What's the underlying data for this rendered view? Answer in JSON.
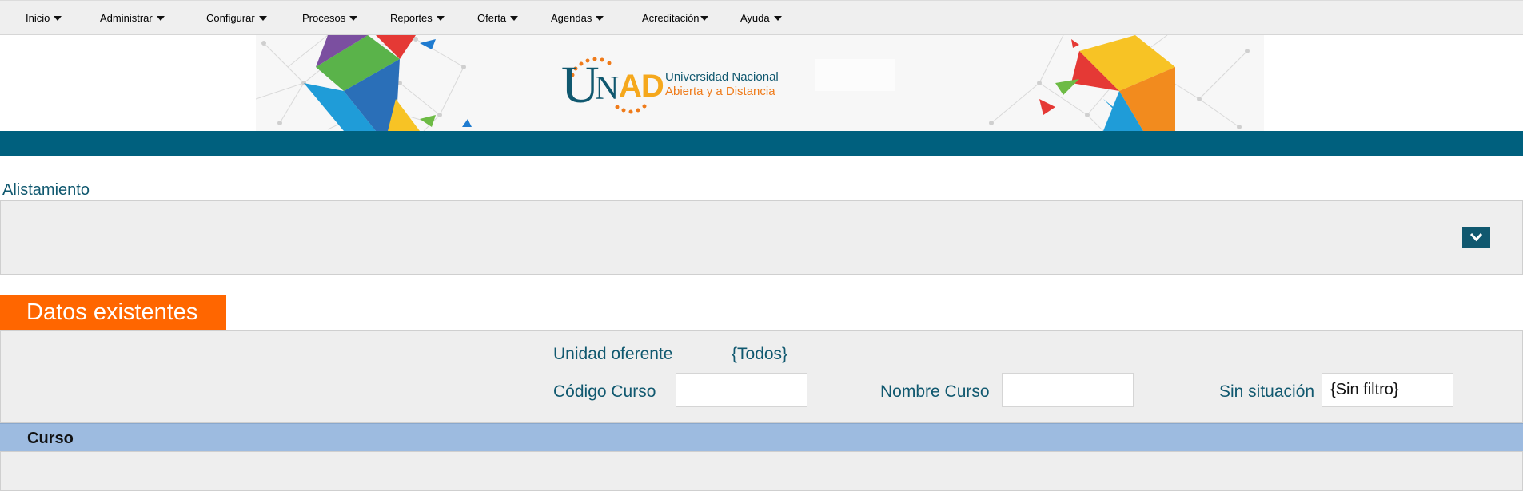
{
  "menu": {
    "items": [
      {
        "label": "Inicio"
      },
      {
        "label": "Administrar"
      },
      {
        "label": "Configurar"
      },
      {
        "label": "Procesos"
      },
      {
        "label": "Reportes"
      },
      {
        "label": "Oferta"
      },
      {
        "label": "Agendas"
      },
      {
        "label": "Acreditación"
      },
      {
        "label": "Ayuda"
      }
    ]
  },
  "banner": {
    "logo_text": "UNAD",
    "line1": "Universidad Nacional",
    "line2": "Abierta y a Distancia"
  },
  "section": {
    "title": "Alistamiento"
  },
  "datos": {
    "tab_label": "Datos existentes",
    "unidad_label": "Unidad oferente",
    "unidad_value": "{Todos}",
    "codigo_label": "Código Curso",
    "codigo_value": "",
    "nombre_label": "Nombre Curso",
    "nombre_value": "",
    "situacion_label": "Sin situación",
    "situacion_value": "{Sin filtro}"
  },
  "grid": {
    "column_header": "Curso"
  },
  "colors": {
    "teal": "#00607e",
    "orange": "#ff6600",
    "header_blue": "#9dbbe0",
    "text_teal": "#10586f"
  }
}
